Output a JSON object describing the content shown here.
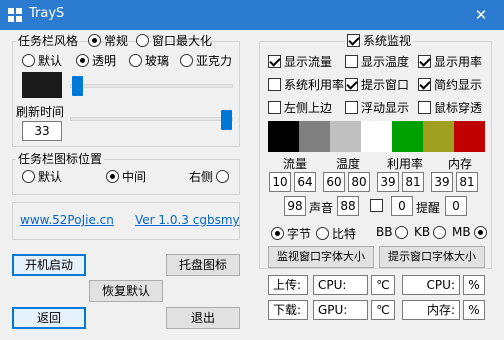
{
  "window": {
    "title": "TrayS",
    "close_glyph": "✕",
    "icon": "window-app-icon",
    "titlebar_color": "#2b7bd1"
  },
  "style_group": {
    "legend": "任务栏风格",
    "mode_options": [
      "常规",
      "窗口最大化"
    ],
    "mode_selected": "常规",
    "transparency_options": [
      "默认",
      "透明",
      "玻璃",
      "亚克力"
    ],
    "transparency_selected": "透明",
    "color_swatch": "#1a1a1a",
    "refresh_label": "刷新时间",
    "refresh_value": "33"
  },
  "icon_position_group": {
    "legend": "任务栏图标位置",
    "options": [
      "默认",
      "中间",
      "右侧"
    ],
    "selected": "中间"
  },
  "links": {
    "website": "www.52PoJie.cn",
    "version": "Ver 1.0.3 cgbsmy",
    "link_color": "#0066cc"
  },
  "buttons": {
    "autostart": "开机启动",
    "tray_icon": "托盘图标",
    "restore_default": "恢复默认",
    "back": "返回",
    "exit": "退出"
  },
  "monitor": {
    "title": "系统监视",
    "enabled": true,
    "checkboxes": [
      {
        "label": "显示流量",
        "checked": true
      },
      {
        "label": "显示温度",
        "checked": false
      },
      {
        "label": "显示用率",
        "checked": true
      },
      {
        "label": "系统利用率",
        "checked": false
      },
      {
        "label": "提示窗口",
        "checked": true
      },
      {
        "label": "简约显示",
        "checked": true
      },
      {
        "label": "左侧上边",
        "checked": false
      },
      {
        "label": "浮动显示",
        "checked": false
      },
      {
        "label": "鼠标穿透",
        "checked": false
      }
    ],
    "color_swatches": [
      "#000000",
      "#808080",
      "#c0c0c0",
      "#ffffff",
      "#00a000",
      "#a0a020",
      "#c00000"
    ],
    "column_headers": [
      "流量",
      "温度",
      "利用率",
      "内存"
    ],
    "thresholds": {
      "traffic": [
        "10",
        "64"
      ],
      "temperature": [
        "60",
        "80"
      ],
      "usage": [
        "39",
        "81"
      ],
      "memory": [
        "39",
        "81"
      ]
    },
    "sound_value": "98",
    "sound_label": "声音",
    "sound_level": "88",
    "remind_value": "0",
    "remind_label": "提醒",
    "remind_count": "0",
    "unit_options": [
      "字节",
      "比特"
    ],
    "unit_selected": "字节",
    "size_options": [
      "BB",
      "KB",
      "MB"
    ],
    "size_selected": "MB",
    "font_buttons": [
      "监视窗口字体大小",
      "提示窗口字体大小"
    ],
    "bottom_rows": [
      [
        "上传:",
        "CPU:",
        "℃",
        "CPU:",
        "%"
      ],
      [
        "下载:",
        "GPU:",
        "℃",
        "内存:",
        "%"
      ]
    ]
  }
}
